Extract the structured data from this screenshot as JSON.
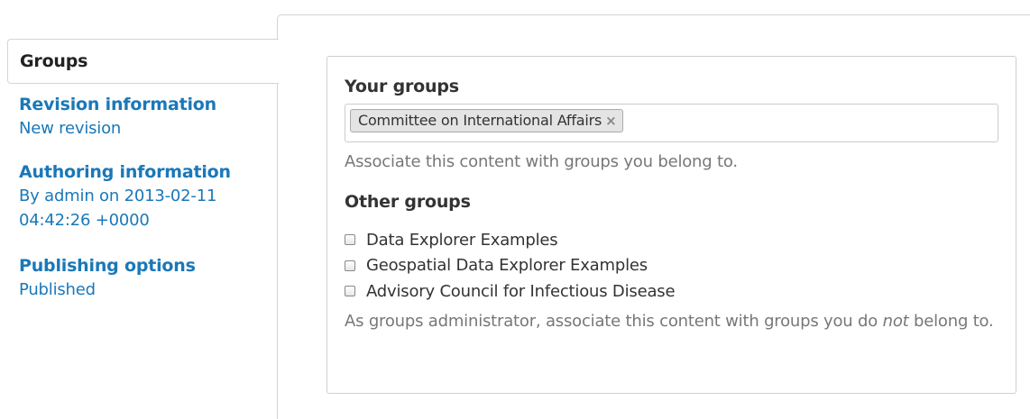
{
  "tabs": {
    "active": {
      "label": "Groups"
    },
    "items": [
      {
        "title": "Revision information",
        "summary": "New revision"
      },
      {
        "title": "Authoring information",
        "summary_line1": "By admin on 2013-02-11",
        "summary_line2": "04:42:26 +0000"
      },
      {
        "title": "Publishing options",
        "summary": "Published"
      }
    ]
  },
  "your_groups": {
    "label": "Your groups",
    "tags": [
      {
        "text": "Committee on International Affairs",
        "remove": "×"
      }
    ],
    "help": "Associate this content with groups you belong to."
  },
  "other_groups": {
    "label": "Other groups",
    "options": [
      {
        "label": "Data Explorer Examples",
        "checked": false
      },
      {
        "label": "Geospatial Data Explorer Examples",
        "checked": false
      },
      {
        "label": "Advisory Council for Infectious Disease",
        "checked": false
      }
    ],
    "help_before": "As groups administrator, associate this content with groups you do ",
    "help_emphasis": "not",
    "help_after": " belong to."
  },
  "colors": {
    "link": "#1a78b8",
    "help_text": "#777777",
    "border": "#d4d4d4",
    "tag_background": "#e4e4e4"
  }
}
